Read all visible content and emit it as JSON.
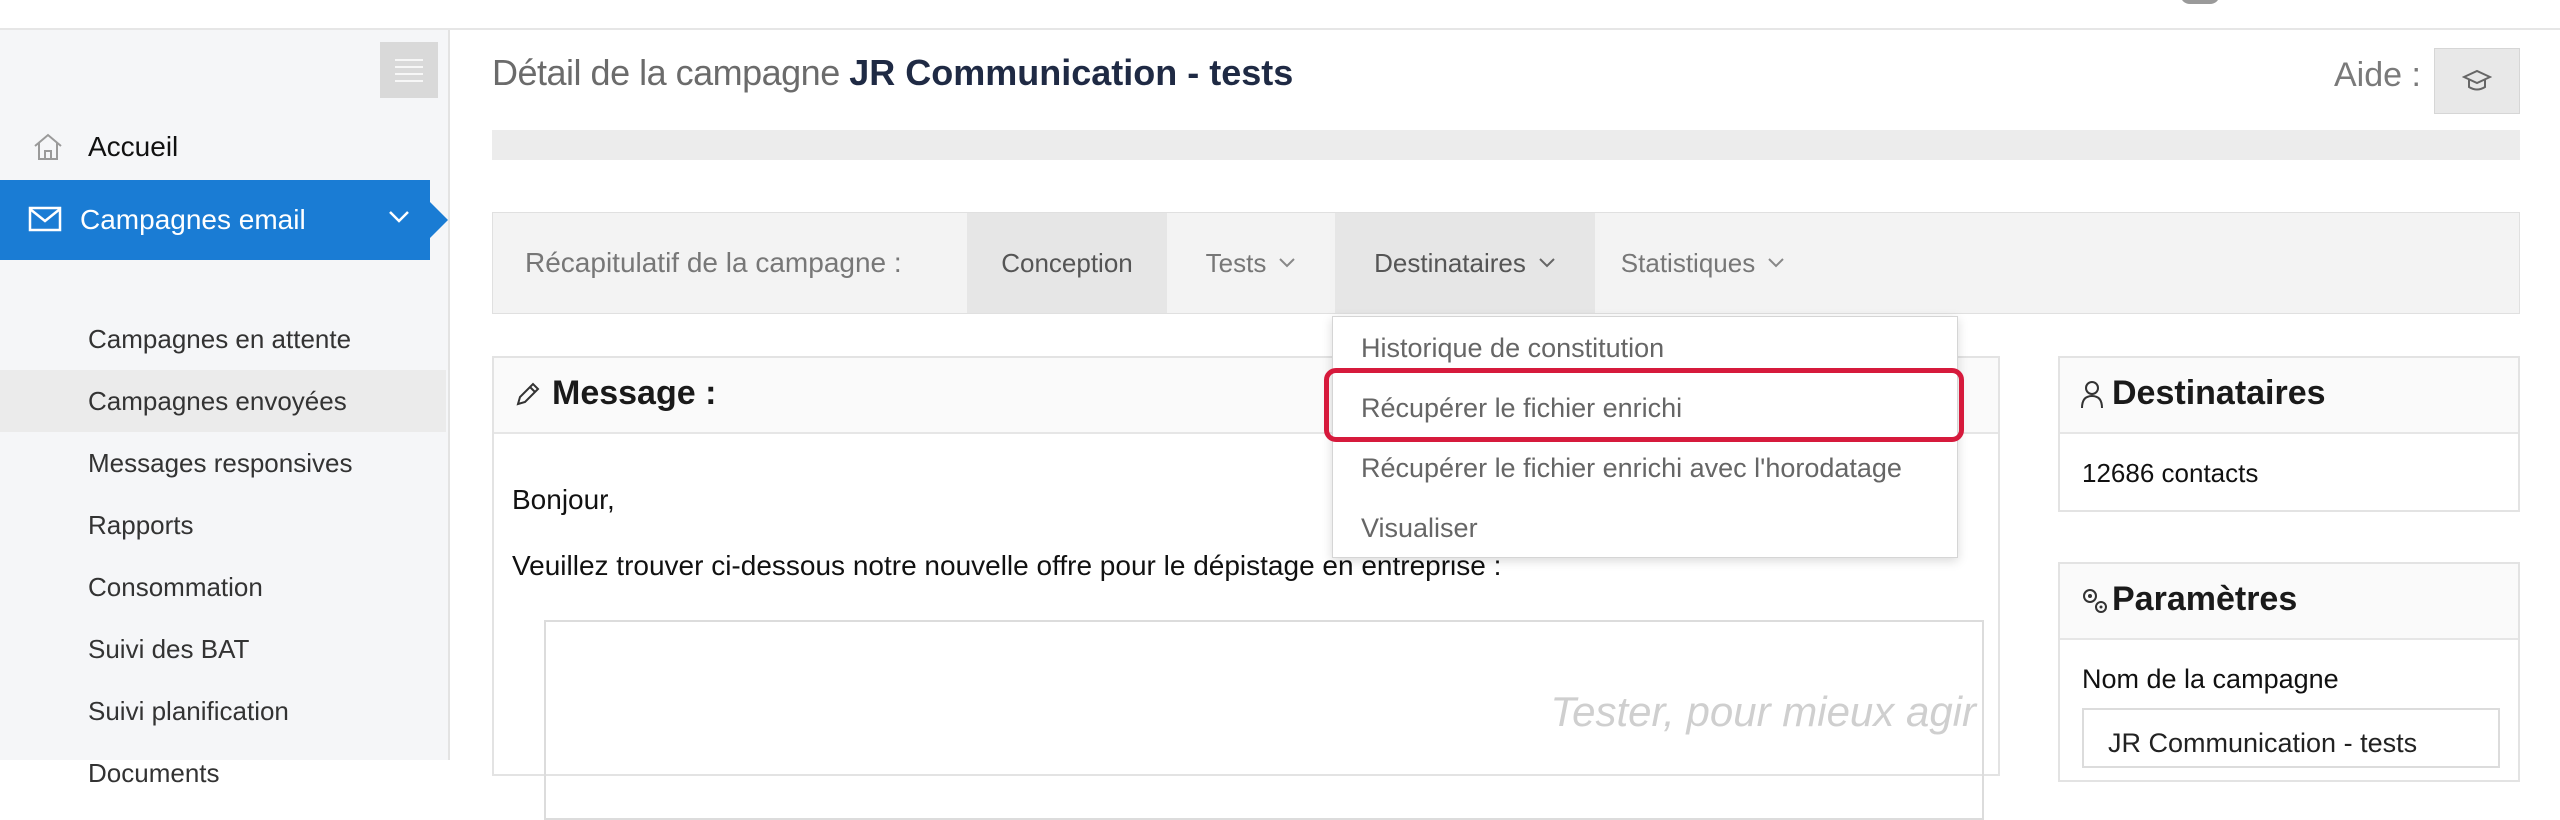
{
  "sidebar": {
    "home_label": "Accueil",
    "email_label": "Campagnes email",
    "subitems": [
      {
        "label": "Campagnes en attente"
      },
      {
        "label": "Campagnes envoyées"
      },
      {
        "label": "Messages responsives"
      },
      {
        "label": "Rapports"
      },
      {
        "label": "Consommation"
      },
      {
        "label": "Suivi des BAT"
      },
      {
        "label": "Suivi planification"
      },
      {
        "label": "Documents"
      }
    ],
    "active_subitem": "Campagnes envoyées"
  },
  "header": {
    "title_prefix": "Détail de la campagne",
    "title_name": "JR Communication - tests",
    "help_label": "Aide :"
  },
  "tabs": {
    "recap_label": "Récapitulatif de la campagne :",
    "conception": "Conception",
    "tests": "Tests",
    "destinataires": "Destinataires",
    "statistiques": "Statistiques"
  },
  "dropdown": {
    "items": [
      {
        "label": "Historique de constitution"
      },
      {
        "label": "Récupérer le fichier enrichi"
      },
      {
        "label": "Récupérer le fichier enrichi avec l'horodatage"
      },
      {
        "label": "Visualiser"
      }
    ],
    "highlighted": "Récupérer le fichier enrichi"
  },
  "message": {
    "title": "Message :",
    "greeting": "Bonjour,",
    "body": "Veuillez trouver ci-dessous notre nouvelle offre pour le dépistage en entreprise :",
    "preview_slogan": "Tester, pour mieux agir"
  },
  "recipients_card": {
    "title": "Destinataires",
    "contacts": "12686 contacts"
  },
  "params_card": {
    "title": "Paramètres",
    "name_label": "Nom de la campagne",
    "name_value": "JR Communication - tests"
  },
  "colors": {
    "accent": "#1a7cd4",
    "highlight": "#d61a3c"
  }
}
